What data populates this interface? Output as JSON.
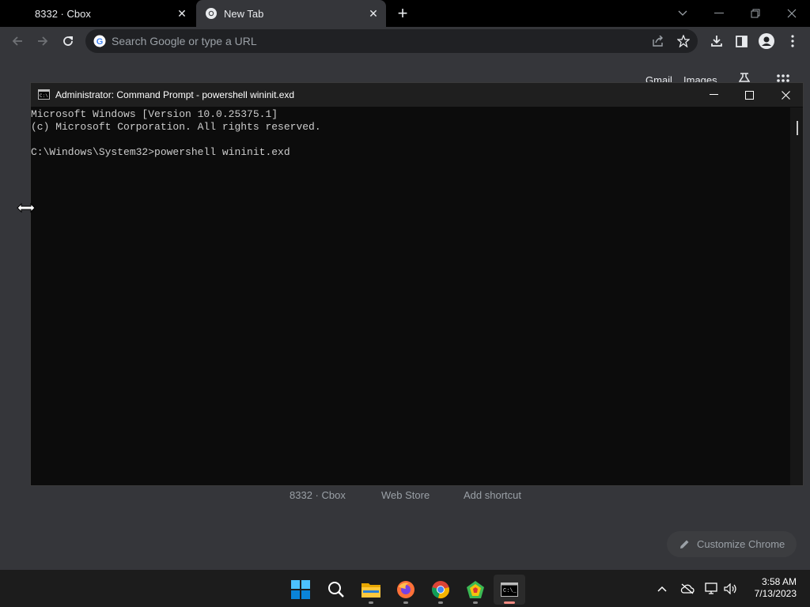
{
  "browser": {
    "tabs": [
      {
        "label": "8332 · Cbox",
        "active": false
      },
      {
        "label": "New Tab",
        "active": true
      }
    ],
    "omnibox": {
      "placeholder": "Search Google or type a URL"
    },
    "ntp": {
      "top_links": [
        "Gmail",
        "Images"
      ],
      "shortcuts": [
        "8332 · Cbox",
        "Web Store",
        "Add shortcut"
      ],
      "customize_label": "Customize Chrome"
    },
    "colors": {
      "accent": "#8ab4f8",
      "background": "#35363a"
    }
  },
  "cmd": {
    "title": "Administrator:  Command Prompt - powershell  wininit.exd",
    "lines": [
      "Microsoft Windows [Version 10.0.25375.1]",
      "(c) Microsoft Corporation. All rights reserved.",
      "",
      "C:\\Windows\\System32>powershell wininit.exd"
    ]
  },
  "taskbar": {
    "apps": [
      "start-icon",
      "search-icon",
      "file-explorer-icon",
      "firefox-icon",
      "chrome-icon",
      "app-icon",
      "terminal-icon"
    ],
    "clock": {
      "time": "3:58 AM",
      "date": "7/13/2023"
    }
  }
}
